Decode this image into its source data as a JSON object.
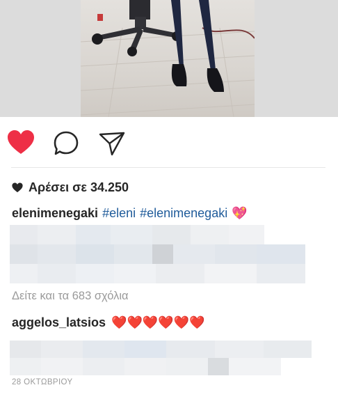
{
  "post": {
    "likes_text": "Αρέσει σε 34.250",
    "caption": {
      "username": "elenimenegaki",
      "hashtags": [
        "#eleni",
        "#elenimenegaki"
      ],
      "emoji": "💖"
    },
    "view_comments_text": "Δείτε και τα 683 σχόλια",
    "comment": {
      "username": "aggelos_latsios",
      "hearts": "❤️❤️❤️❤️❤️❤️"
    },
    "date": "28 ΟΚΤΩΒΡΙΟΥ",
    "liked": true
  },
  "colors": {
    "like_heart": "#ee2f46",
    "hashtag": "#1f5b9a",
    "muted": "#9a9a9a",
    "text": "#262626"
  },
  "icons": {
    "like": "heart-icon",
    "comment": "comment-icon",
    "share": "send-icon",
    "likes_count": "heart-small-icon"
  }
}
